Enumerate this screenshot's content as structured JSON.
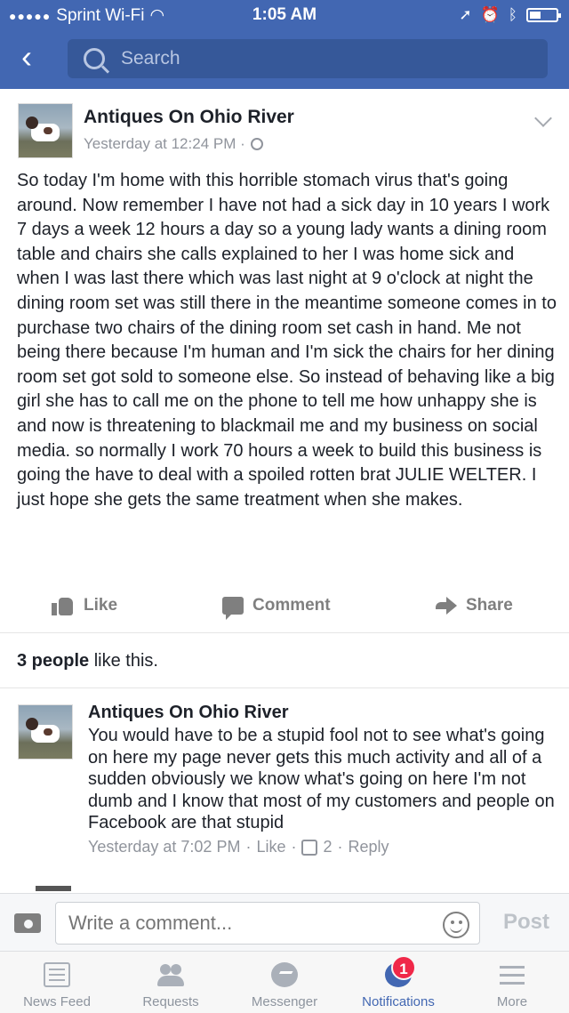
{
  "status_bar": {
    "carrier": "Sprint Wi-Fi",
    "time": "1:05 AM"
  },
  "header": {
    "search_placeholder": "Search"
  },
  "post": {
    "page_name": "Antiques On Ohio River",
    "timestamp": "Yesterday at 12:24 PM · ",
    "body": "So today I'm home with this horrible stomach virus that's going around. Now remember I have not had a sick day in 10 years I work 7 days a week 12 hours a day so a young lady wants a dining room table and chairs she calls explained to her I was home sick and when I was last there which was last night at 9 o'clock at night the dining room set was still there in the meantime someone comes in to purchase two chairs of the dining room set cash in hand. Me not being there because I'm human and I'm sick the chairs for her dining room set got sold to someone else. So instead of behaving like a big girl she has to call me on the phone to tell me how unhappy she is and now is threatening to blackmail me and my business on social media. so normally I work 70 hours a week to build this business is going the have to deal with a spoiled rotten brat JULIE WELTER. I just hope she gets the same treatment when she makes.",
    "actions": {
      "like": "Like",
      "comment": "Comment",
      "share": "Share"
    },
    "likes_count": "3 people",
    "likes_suffix": " like this."
  },
  "comment": {
    "author": "Antiques On Ohio River",
    "text": "You would have to be a stupid fool not to see what's going on here my page never gets this much activity and all of a sudden obviously we know what's going on here I'm not dumb and I know that most of my customers and people on Facebook are that stupid",
    "time": "Yesterday at 7:02 PM",
    "like_label": "Like",
    "like_count": "2",
    "reply_label": "Reply"
  },
  "composer": {
    "placeholder": "Write a comment...",
    "post_label": "Post"
  },
  "tabbar": {
    "tabs": [
      {
        "label": "News Feed"
      },
      {
        "label": "Requests"
      },
      {
        "label": "Messenger"
      },
      {
        "label": "Notifications",
        "badge": "1"
      },
      {
        "label": "More"
      }
    ]
  },
  "colors": {
    "brand": "#4267b2",
    "badge": "#f02849"
  }
}
